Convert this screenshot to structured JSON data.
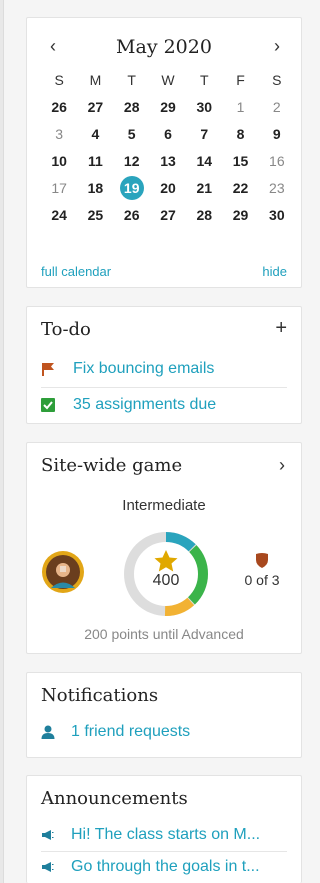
{
  "calendar": {
    "title": "May 2020",
    "prev_glyph": "‹",
    "next_glyph": "›",
    "weekdays": [
      "S",
      "M",
      "T",
      "W",
      "T",
      "F",
      "S"
    ],
    "weeks": [
      [
        {
          "d": "26",
          "s": "bold"
        },
        {
          "d": "27",
          "s": "bold"
        },
        {
          "d": "28",
          "s": "bold"
        },
        {
          "d": "29",
          "s": "bold"
        },
        {
          "d": "30",
          "s": "bold"
        },
        {
          "d": "1",
          "s": "light"
        },
        {
          "d": "2",
          "s": "light"
        }
      ],
      [
        {
          "d": "3",
          "s": "light"
        },
        {
          "d": "4",
          "s": "bold"
        },
        {
          "d": "5",
          "s": "bold"
        },
        {
          "d": "6",
          "s": "bold"
        },
        {
          "d": "7",
          "s": "bold"
        },
        {
          "d": "8",
          "s": "bold"
        },
        {
          "d": "9",
          "s": "bold"
        }
      ],
      [
        {
          "d": "10",
          "s": "bold"
        },
        {
          "d": "11",
          "s": "bold"
        },
        {
          "d": "12",
          "s": "bold"
        },
        {
          "d": "13",
          "s": "bold"
        },
        {
          "d": "14",
          "s": "bold"
        },
        {
          "d": "15",
          "s": "bold"
        },
        {
          "d": "16",
          "s": "light"
        }
      ],
      [
        {
          "d": "17",
          "s": "light"
        },
        {
          "d": "18",
          "s": "bold"
        },
        {
          "d": "19",
          "s": "today"
        },
        {
          "d": "20",
          "s": "bold"
        },
        {
          "d": "21",
          "s": "bold"
        },
        {
          "d": "22",
          "s": "bold"
        },
        {
          "d": "23",
          "s": "light"
        }
      ],
      [
        {
          "d": "24",
          "s": "bold"
        },
        {
          "d": "25",
          "s": "bold"
        },
        {
          "d": "26",
          "s": "bold"
        },
        {
          "d": "27",
          "s": "bold"
        },
        {
          "d": "28",
          "s": "bold"
        },
        {
          "d": "29",
          "s": "bold"
        },
        {
          "d": "30",
          "s": "bold"
        }
      ]
    ],
    "full_calendar_label": "full calendar",
    "hide_label": "hide"
  },
  "todo": {
    "title": "To-do",
    "add_glyph": "+",
    "items": [
      {
        "label": "Fix bouncing emails",
        "icon": "flag-icon",
        "color": "#c0541f"
      },
      {
        "label": "35 assignments due",
        "icon": "checkbox-icon",
        "color": "#2e9e3a"
      }
    ]
  },
  "game": {
    "title": "Site-wide game",
    "chevron_glyph": "›",
    "level": "Intermediate",
    "points": "400",
    "badges": "0 of 3",
    "until_text": "200 points until Advanced",
    "ring_colors": [
      "#2aa4bd",
      "#3bb44a",
      "#f2b233",
      "#dddddd"
    ],
    "star_color": "#e0a800",
    "shield_color": "#a8481e"
  },
  "notifications": {
    "title": "Notifications",
    "item": "1 friend requests"
  },
  "announcements": {
    "title": "Announcements",
    "items": [
      "Hi! The class starts on M...",
      "Go through the goals in t..."
    ]
  },
  "colors": {
    "link": "#1fa0bd",
    "today": "#2aa4bd"
  }
}
